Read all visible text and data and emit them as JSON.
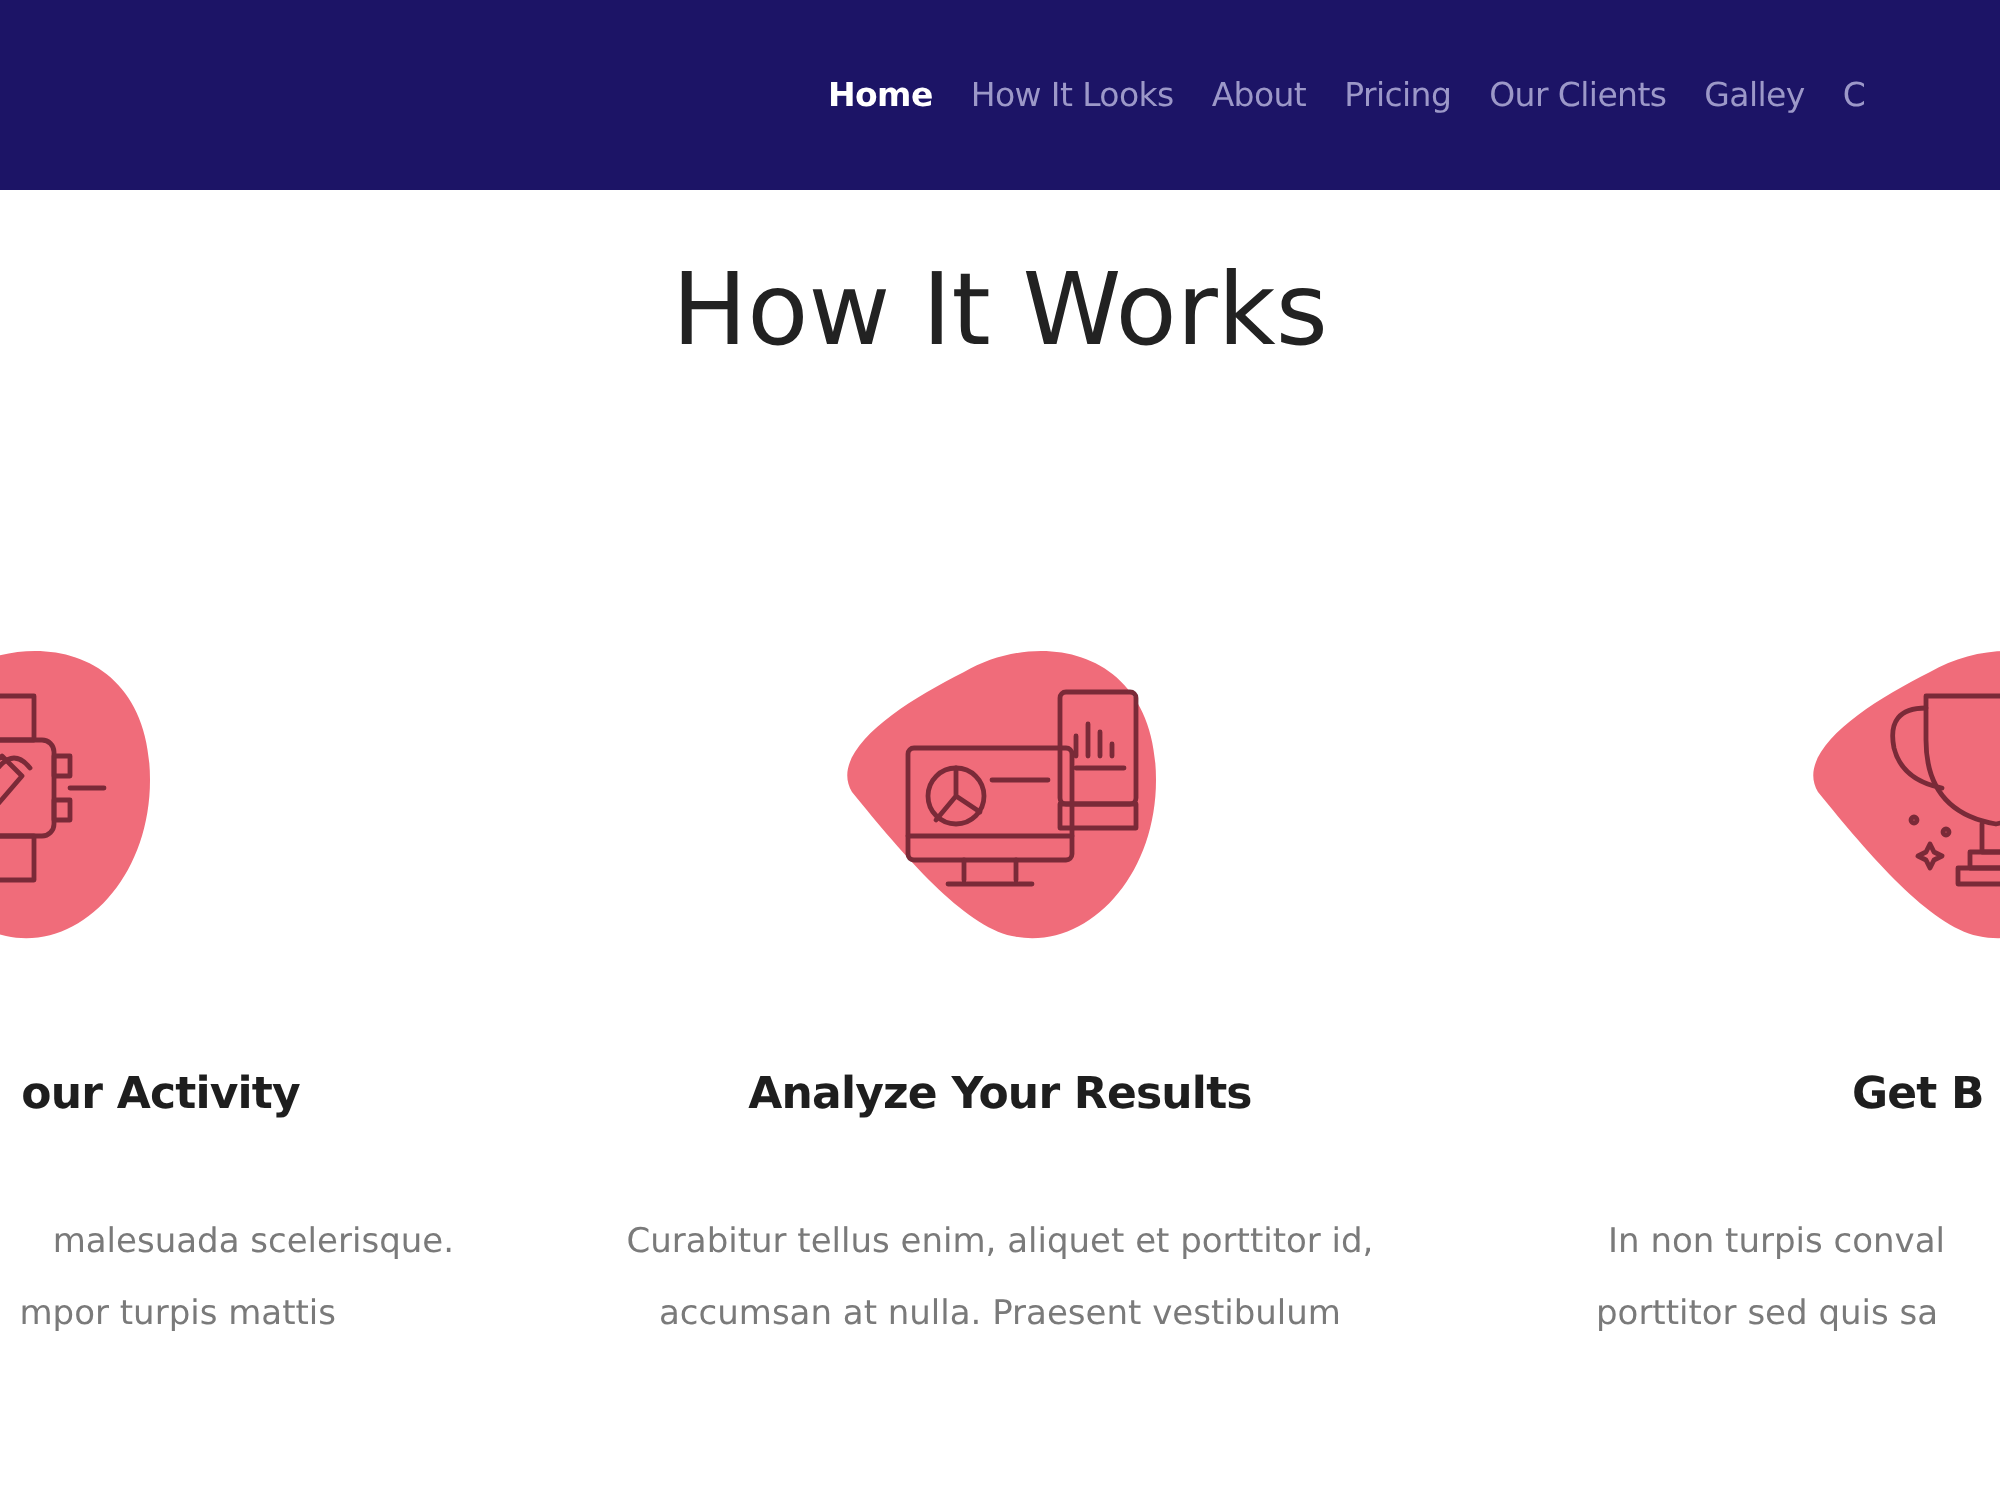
{
  "nav": {
    "items": [
      {
        "label": "Home",
        "selected": true
      },
      {
        "label": "How It Looks",
        "selected": false
      },
      {
        "label": "About",
        "selected": false
      },
      {
        "label": "Pricing",
        "selected": false
      },
      {
        "label": "Our Clients",
        "selected": false
      },
      {
        "label": "Galley",
        "selected": false
      },
      {
        "label": "C",
        "selected": false
      }
    ]
  },
  "section": {
    "title": "How It Works"
  },
  "cards": [
    {
      "kind": "gadget",
      "title": "our Activity",
      "lines": [
        "malesuada scelerisque.",
        "mpor turpis mattis"
      ]
    },
    {
      "kind": "monitor",
      "title": "Analyze Your Results",
      "lines": [
        "Curabitur tellus enim, aliquet et porttitor id,",
        "accumsan at nulla. Praesent vestibulum"
      ]
    },
    {
      "kind": "trophy",
      "title": "Get B",
      "lines": [
        "In non turpis conval",
        "porttitor sed quis sa"
      ]
    }
  ]
}
